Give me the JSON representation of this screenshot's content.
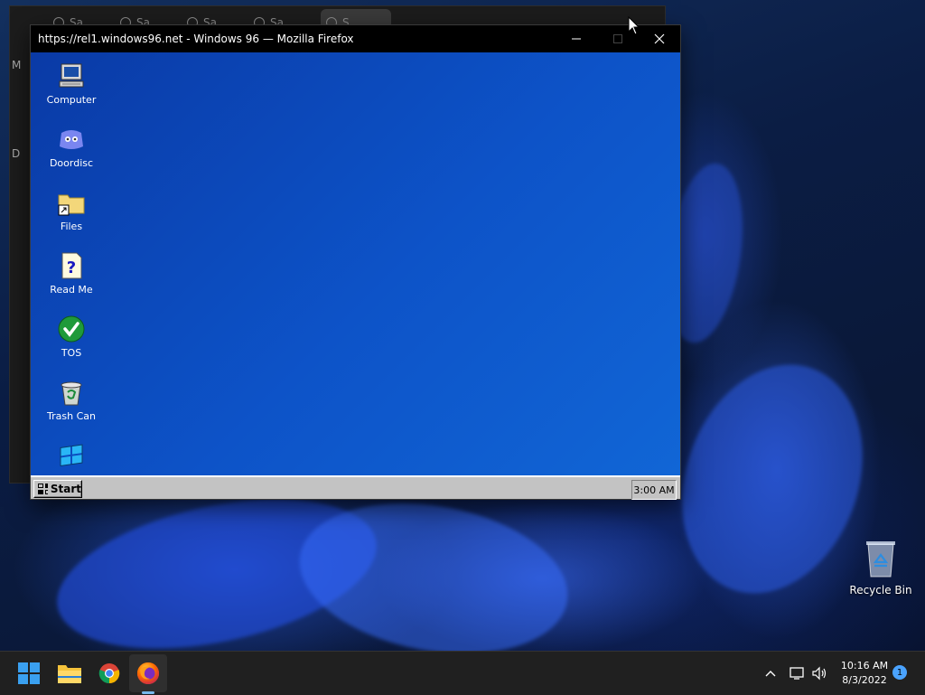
{
  "firefox_window": {
    "title": "https://rel1.windows96.net - Windows 96 — Mozilla Firefox"
  },
  "w96": {
    "desktop_icons": [
      {
        "label": "Computer",
        "icon": "computer-icon"
      },
      {
        "label": "Doordisc",
        "icon": "doordisc-icon"
      },
      {
        "label": "Files",
        "icon": "folder-icon"
      },
      {
        "label": "Read Me",
        "icon": "readme-icon"
      },
      {
        "label": "TOS",
        "icon": "checkmark-icon"
      },
      {
        "label": "Trash Can",
        "icon": "trash-icon"
      },
      {
        "label": "",
        "icon": "windows96-logo-icon"
      }
    ],
    "start_label": "Start",
    "clock": "3:00 AM"
  },
  "desktop": {
    "recycle_bin_label": "Recycle Bin"
  },
  "background_window": {
    "side_labels": [
      "M",
      "D"
    ],
    "tabs": [
      "Sa",
      "Sa",
      "Sa",
      "Sa",
      "S"
    ]
  },
  "taskbar": {
    "apps": [
      "start-icon",
      "file-explorer-icon",
      "chrome-icon",
      "firefox-icon"
    ],
    "time": "10:16 AM",
    "date": "8/3/2022",
    "notification_count": "1"
  },
  "colors": {
    "w96_desktop": "#0d53c8",
    "w96_taskbar": "#c3c3c3",
    "win11_taskbar": "#202020",
    "accent": "#76b9ed"
  }
}
